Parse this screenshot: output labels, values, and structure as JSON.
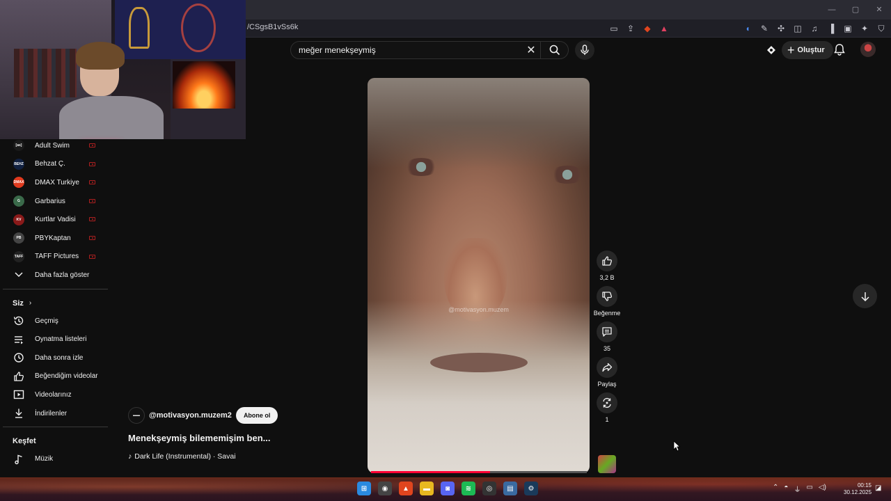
{
  "browser": {
    "url": "/CSgsB1vSs6k",
    "window_controls": [
      "—",
      "▢",
      "✕"
    ]
  },
  "header": {
    "search_value": "meğer menekşeymiş",
    "create_label": "Oluştur"
  },
  "sidebar": {
    "subscriptions": [
      {
        "label": "Adult Swim",
        "icon_text": "[as]",
        "color": "#1a1a1a"
      },
      {
        "label": "Behzat Ç.",
        "icon_text": "BEHZ",
        "color": "#102040"
      },
      {
        "label": "DMAX Turkiye",
        "icon_text": "DMAX",
        "color": "#e03a1e"
      },
      {
        "label": "Garbarius",
        "icon_text": "G",
        "color": "#3a6a4a"
      },
      {
        "label": "Kurtlar Vadisi",
        "icon_text": "KV",
        "color": "#8a1a1a"
      },
      {
        "label": "PBYKaptan",
        "icon_text": "PB",
        "color": "#444444"
      },
      {
        "label": "TAFF Pictures",
        "icon_text": "TAFF",
        "color": "#222222"
      }
    ],
    "show_more": "Daha fazla göster",
    "you_section": "Siz",
    "you_items": [
      {
        "label": "Geçmiş",
        "icon": "history-icon"
      },
      {
        "label": "Oynatma listeleri",
        "icon": "playlists-icon"
      },
      {
        "label": "Daha sonra izle",
        "icon": "watch-later-icon"
      },
      {
        "label": "Beğendiğim videolar",
        "icon": "liked-icon"
      },
      {
        "label": "Videolarınız",
        "icon": "your-videos-icon"
      },
      {
        "label": "İndirilenler",
        "icon": "downloads-icon"
      }
    ],
    "explore_section": "Keşfet",
    "explore_items": [
      {
        "label": "Müzik",
        "icon": "music-icon"
      }
    ]
  },
  "video": {
    "watermark": "@motivasyon.muzem",
    "progress": 0.55,
    "channel_name": "@motivasyon.muzem2",
    "subscribe_label": "Abone ol",
    "title": "Menekşeymiş bilememişim ben...",
    "music": "Dark Life (Instrumental) · Savai"
  },
  "actions": {
    "likes": "3,2 B",
    "dislike": "Beğenme",
    "comments": "35",
    "share": "Paylaş",
    "remix": "1"
  },
  "taskbar": {
    "time": "00:15",
    "date": "30.12.2025",
    "apps": [
      {
        "name": "windows-start-icon",
        "glyph": "⊞",
        "color": "#2a8ae0"
      },
      {
        "name": "chrome-icon",
        "glyph": "◉",
        "color": "#444"
      },
      {
        "name": "brave-icon",
        "glyph": "▲",
        "color": "#e0451e"
      },
      {
        "name": "file-explorer-icon",
        "glyph": "▬",
        "color": "#e8b820"
      },
      {
        "name": "discord-icon",
        "glyph": "◙",
        "color": "#5865f2"
      },
      {
        "name": "spotify-icon",
        "glyph": "≋",
        "color": "#1db954"
      },
      {
        "name": "obs-icon",
        "glyph": "◎",
        "color": "#333"
      },
      {
        "name": "window-app-icon",
        "glyph": "▤",
        "color": "#3a6aa0"
      },
      {
        "name": "steam-icon",
        "glyph": "⚙",
        "color": "#1a3a5a"
      }
    ]
  },
  "colors": {
    "accent": "#ff0033",
    "background": "#0f0f0f"
  }
}
